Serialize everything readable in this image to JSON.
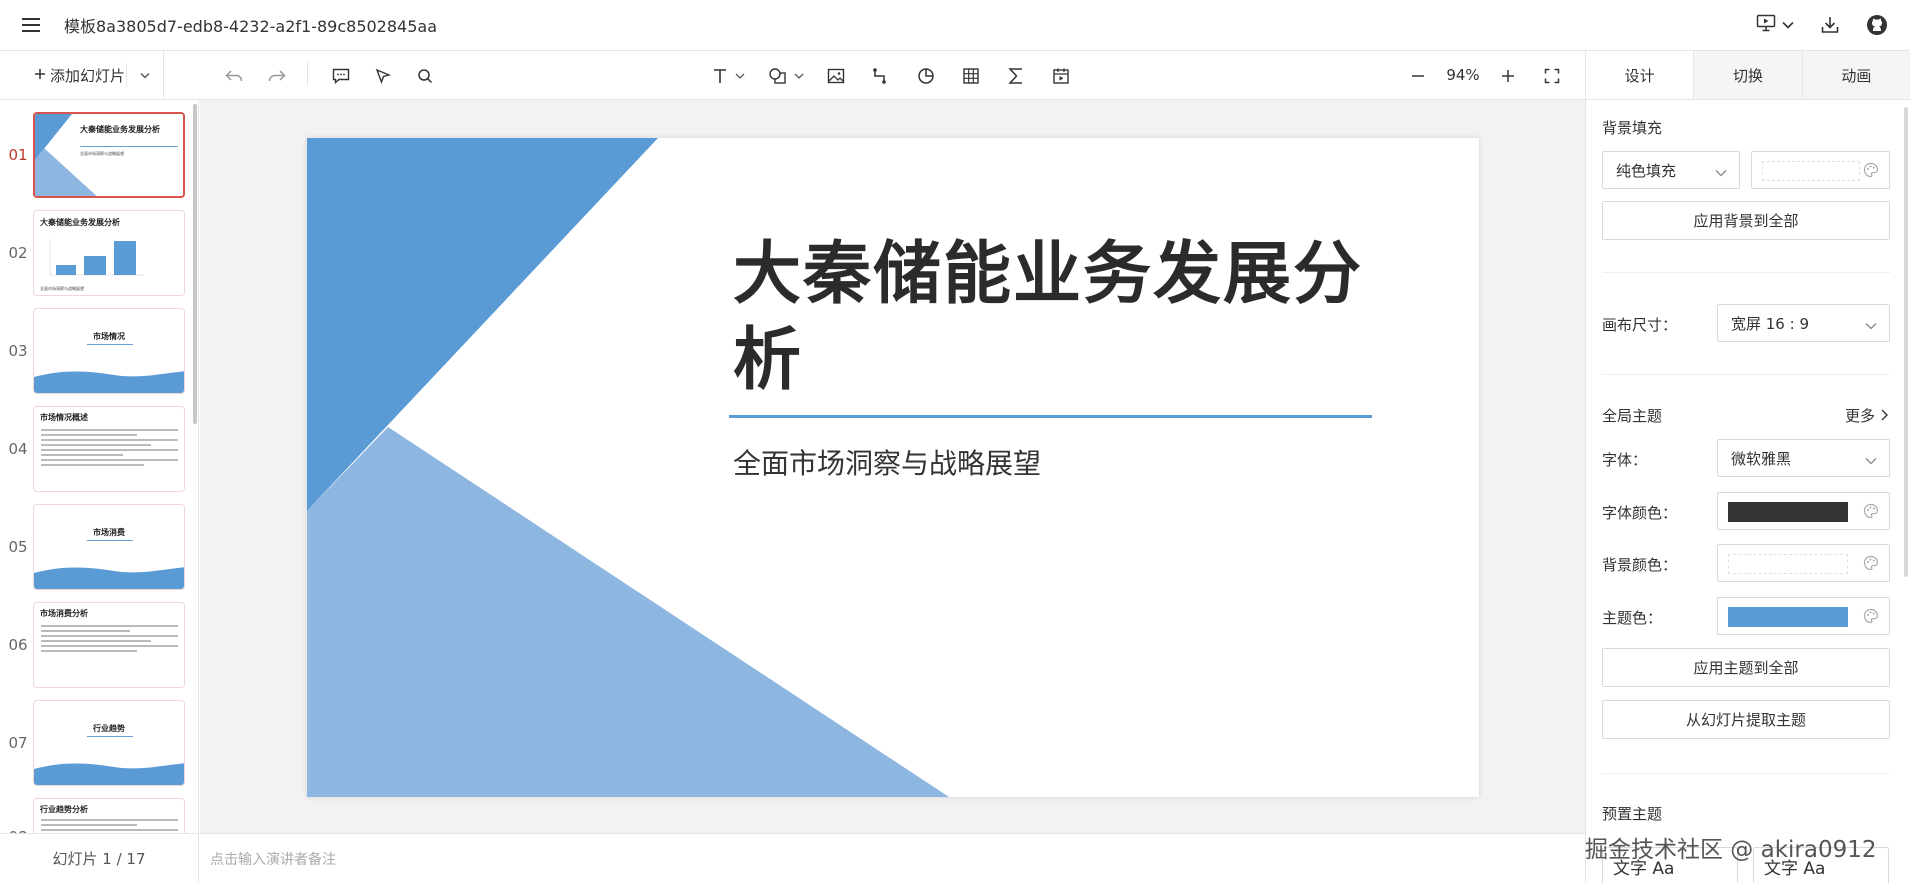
{
  "header": {
    "document_title": "模板8a3805d7-edb8-4232-a2f1-89c8502845aa",
    "icons": [
      "menu-icon",
      "present-icon",
      "chevron-down-icon",
      "download-icon",
      "github-icon"
    ]
  },
  "toolbar": {
    "add_slide_label": "添加幻灯片",
    "zoom": "94%",
    "icons": [
      "undo-icon",
      "redo-icon",
      "comment-icon",
      "select-icon",
      "search-icon",
      "text-icon",
      "shape-icon",
      "image-icon",
      "line-icon",
      "chart-icon",
      "table-icon",
      "formula-icon",
      "media-icon",
      "zoom-out-icon",
      "zoom-in-icon",
      "fullscreen-icon"
    ]
  },
  "thumbnails": {
    "active_index": 0,
    "items": [
      {
        "num": "01",
        "title": "大秦储能业务发展分析",
        "subtitle": "全面市场洞察与战略展望",
        "kind": "cover"
      },
      {
        "num": "02",
        "title": "大秦储能业务发展分析",
        "footer": "全面市场洞察与战略展望",
        "kind": "chart"
      },
      {
        "num": "03",
        "title": "市场情况",
        "kind": "section"
      },
      {
        "num": "04",
        "title": "市场情况概述",
        "kind": "text"
      },
      {
        "num": "05",
        "title": "市场消费",
        "kind": "section"
      },
      {
        "num": "06",
        "title": "市场消费分析",
        "kind": "text"
      },
      {
        "num": "07",
        "title": "行业趋势",
        "kind": "section"
      },
      {
        "num": "08",
        "title": "行业趋势分析",
        "kind": "text"
      }
    ],
    "footer": "幻灯片 1 / 17"
  },
  "slide": {
    "title": "大秦储能业务发展分析",
    "subtitle": "全面市场洞察与战略展望",
    "colors": {
      "dark_blue": "#5b9bd5",
      "light_blue": "#8db6e0",
      "rule": "#5b9bd5"
    }
  },
  "notes": {
    "placeholder": "点击输入演讲者备注"
  },
  "panel": {
    "tabs": [
      "设计",
      "切换",
      "动画"
    ],
    "active_tab": 0,
    "background_fill": {
      "label": "背景填充",
      "type": "纯色填充",
      "color": "#ffffff"
    },
    "apply_background_all": "应用背景到全部",
    "canvas_size": {
      "label": "画布尺寸：",
      "value": "宽屏 16 : 9"
    },
    "global_theme": {
      "label": "全局主题",
      "more": "更多"
    },
    "font": {
      "label": "字体：",
      "value": "微软雅黑"
    },
    "font_color": {
      "label": "字体颜色：",
      "color": "#333333"
    },
    "bg_color": {
      "label": "背景颜色：",
      "color": "#ffffff"
    },
    "theme_color": {
      "label": "主题色：",
      "color": "#5b9bd5"
    },
    "apply_theme_all": "应用主题到全部",
    "extract_theme": "从幻灯片提取主题",
    "preset_theme": {
      "label": "预置主题",
      "samples": [
        "文字 Aa",
        "文字 Aa"
      ]
    }
  },
  "watermark": "掘金技术社区 @ akira0912"
}
